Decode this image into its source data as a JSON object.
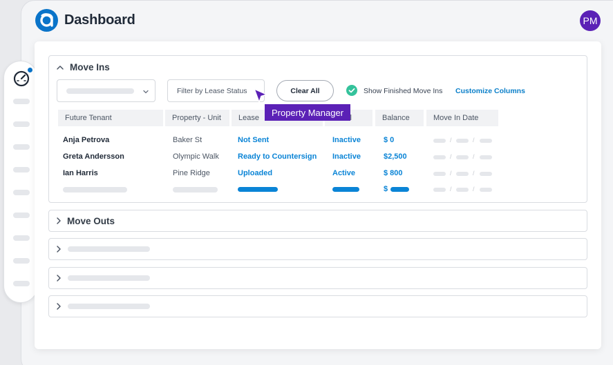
{
  "header": {
    "title": "Dashboard",
    "avatar_initials": "PM"
  },
  "colors": {
    "brand": "#0a74c9",
    "accent_purple": "#5b21b6",
    "link_blue": "#0a84d6",
    "success_green": "#34c29b"
  },
  "sidebar": {
    "icons": [
      "gauge-icon"
    ]
  },
  "move_ins": {
    "title": "Move Ins",
    "filter_label": "Filter by Lease Status",
    "clear_label": "Clear All",
    "show_finished_label": "Show Finished Move Ins",
    "show_finished_checked": true,
    "customize_label": "Customize Columns",
    "columns": [
      "Future Tenant",
      "Property - Unit",
      "Lease",
      "l",
      "Balance",
      "Move In Date"
    ],
    "rows": [
      {
        "tenant": "Anja Petrova",
        "property": "Baker St",
        "lease": "Not Sent",
        "status": "Inactive",
        "balance": "$ 0"
      },
      {
        "tenant": "Greta Andersson",
        "property": "Olympic Walk",
        "lease": "Ready to Countersign",
        "status": "Inactive",
        "balance": "$2,500"
      },
      {
        "tenant": "Ian Harris",
        "property": "Pine Ridge",
        "lease": "Uploaded",
        "status": "Active",
        "balance": "$ 800"
      }
    ],
    "placeholder_balance_prefix": "$",
    "date_separator": "/"
  },
  "move_outs": {
    "title": "Move Outs"
  },
  "tooltip": {
    "text": "Property Manager"
  }
}
